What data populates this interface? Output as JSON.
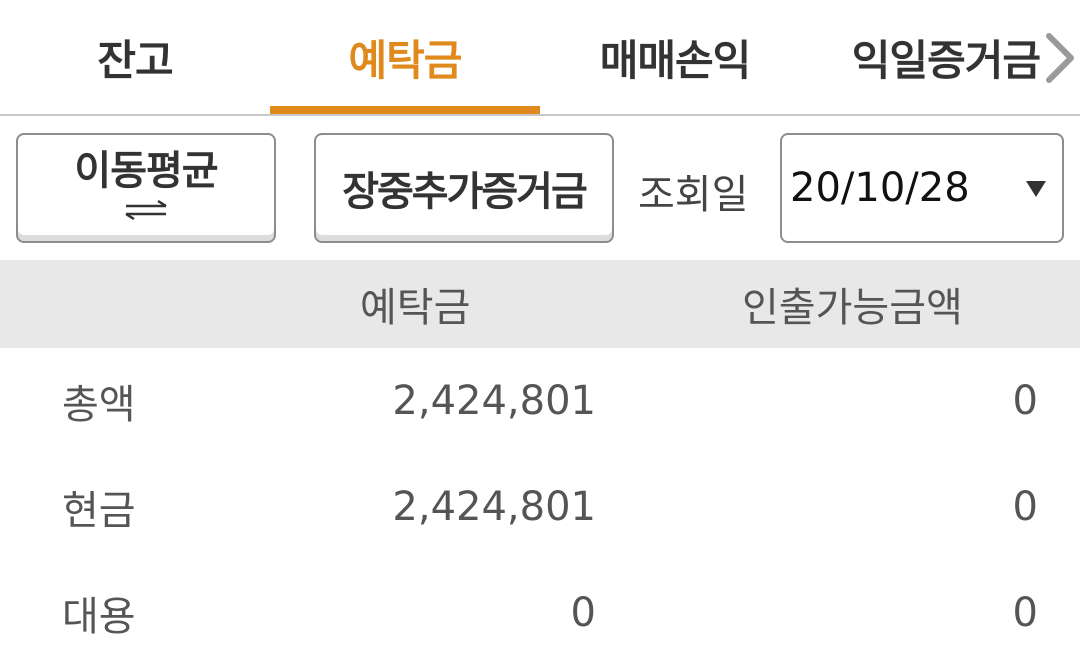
{
  "tabs": [
    {
      "label": "잔고",
      "active": false
    },
    {
      "label": "예탁금",
      "active": true
    },
    {
      "label": "매매손익",
      "active": false
    },
    {
      "label": "익일증거금",
      "active": false
    }
  ],
  "tab_more_icon": "chevron-right-icon",
  "colors": {
    "accent": "#e08a1e",
    "header_bg": "#e8e8e8",
    "text": "#555555"
  },
  "toolbar": {
    "moving_average_label": "이동평균",
    "moving_average_icon": "swap-arrows-icon",
    "margin_call_label": "장중추가증거금",
    "query_date_label": "조회일",
    "query_date_value": "20/10/28",
    "dropdown_icon": "caret-down-icon"
  },
  "table": {
    "headers": [
      "예탁금",
      "인출가능금액"
    ],
    "rows": [
      {
        "label": "총액",
        "deposit": "2,424,801",
        "withdrawable": "0"
      },
      {
        "label": "현금",
        "deposit": "2,424,801",
        "withdrawable": "0"
      },
      {
        "label": "대용",
        "deposit": "0",
        "withdrawable": "0"
      }
    ]
  }
}
